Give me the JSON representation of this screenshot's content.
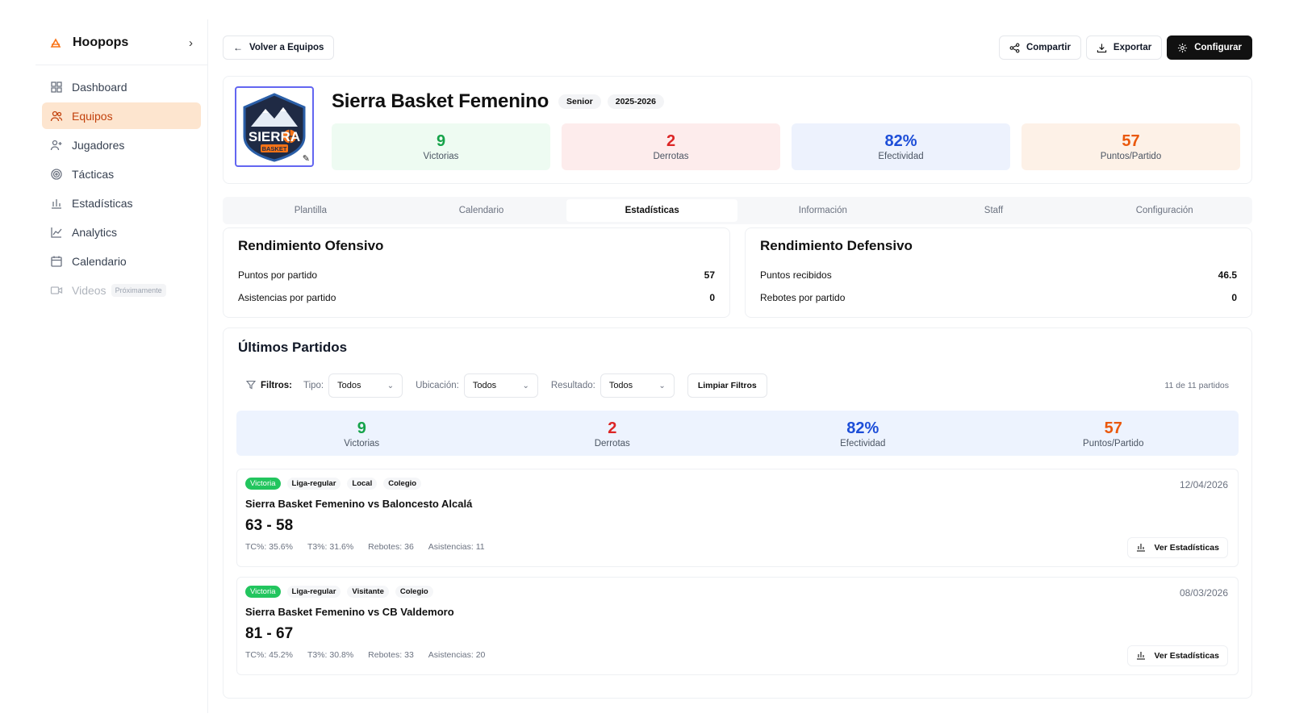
{
  "sidebar": {
    "brand": "Hoopops",
    "items": [
      {
        "label": "Dashboard"
      },
      {
        "label": "Equipos"
      },
      {
        "label": "Jugadores"
      },
      {
        "label": "Tácticas"
      },
      {
        "label": "Estadísticas"
      },
      {
        "label": "Analytics"
      },
      {
        "label": "Calendario"
      },
      {
        "label": "Videos",
        "badge": "Próximamente"
      }
    ]
  },
  "topbar": {
    "back_label": "Volver a Equipos",
    "share_label": "Compartir",
    "export_label": "Exportar",
    "config_label": "Configurar"
  },
  "team": {
    "name": "Sierra Basket Femenino",
    "category": "Senior",
    "season": "2025-2026",
    "logo_text": "SIERRA",
    "logo_subtext": "BASKET",
    "stats": [
      {
        "value": "9",
        "label": "Victorias",
        "color": "#16a34a"
      },
      {
        "value": "2",
        "label": "Derrotas",
        "color": "#dc2626"
      },
      {
        "value": "82%",
        "label": "Efectividad",
        "color": "#1d4ed8"
      },
      {
        "value": "57",
        "label": "Puntos/Partido",
        "color": "#ea580c"
      }
    ]
  },
  "tabs": [
    "Plantilla",
    "Calendario",
    "Estadísticas",
    "Información",
    "Staff",
    "Configuración"
  ],
  "offense": {
    "title": "Rendimiento Ofensivo",
    "rows": [
      {
        "label": "Puntos por partido",
        "value": "57"
      },
      {
        "label": "Asistencias por partido",
        "value": "0"
      }
    ]
  },
  "defense": {
    "title": "Rendimiento Defensivo",
    "rows": [
      {
        "label": "Puntos recibidos",
        "value": "46.5"
      },
      {
        "label": "Rebotes por partido",
        "value": "0"
      }
    ]
  },
  "matches": {
    "title": "Últimos Partidos",
    "filters": {
      "label": "Filtros:",
      "type_label": "Tipo:",
      "type_value": "Todos",
      "location_label": "Ubicación:",
      "location_value": "Todos",
      "result_label": "Resultado:",
      "result_value": "Todos",
      "clear_label": "Limpiar Filtros",
      "count": "11 de 11 partidos"
    },
    "summary": [
      {
        "value": "9",
        "label": "Victorias"
      },
      {
        "value": "2",
        "label": "Derrotas"
      },
      {
        "value": "82%",
        "label": "Efectividad"
      },
      {
        "value": "57",
        "label": "Puntos/Partido"
      }
    ],
    "items": [
      {
        "result": "Victoria",
        "competition": "Liga-regular",
        "venue": "Local",
        "level": "Colegio",
        "date": "12/04/2026",
        "title": "Sierra Basket Femenino vs Baloncesto Alcalá",
        "score": "63 - 58",
        "tc": "TC%: 35.6%",
        "t3": "T3%: 31.6%",
        "rebounds": "Rebotes: 36",
        "assists": "Asistencias: 11",
        "button": "Ver Estadísticas"
      },
      {
        "result": "Victoria",
        "competition": "Liga-regular",
        "venue": "Visitante",
        "level": "Colegio",
        "date": "08/03/2026",
        "title": "Sierra Basket Femenino vs CB Valdemoro",
        "score": "81 - 67",
        "tc": "TC%: 45.2%",
        "t3": "T3%: 30.8%",
        "rebounds": "Rebotes: 33",
        "assists": "Asistencias: 20",
        "button": "Ver Estadísticas"
      }
    ]
  }
}
